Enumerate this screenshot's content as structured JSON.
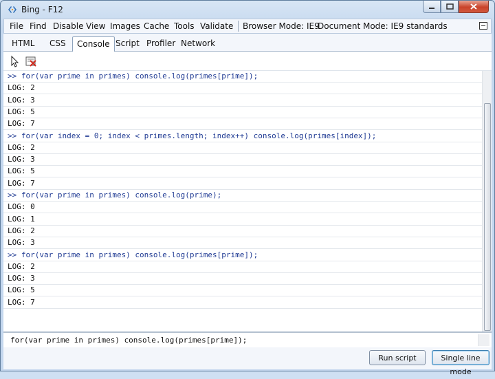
{
  "window": {
    "title": "Bing - F12"
  },
  "menubar": {
    "items": [
      "File",
      "Find",
      "Disable",
      "View",
      "Images",
      "Cache",
      "Tools",
      "Validate"
    ],
    "browser_mode": "Browser Mode: IE9",
    "document_mode": "Document Mode: IE9 standards"
  },
  "tabs": [
    "HTML",
    "CSS",
    "Console",
    "Script",
    "Profiler",
    "Network"
  ],
  "active_tab": "Console",
  "console": {
    "lines": [
      {
        "type": "cmd",
        "text": ">> for(var prime in primes) console.log(primes[prime]);"
      },
      {
        "type": "log",
        "text": "LOG: 2"
      },
      {
        "type": "log",
        "text": "LOG: 3"
      },
      {
        "type": "log",
        "text": "LOG: 5"
      },
      {
        "type": "log",
        "text": "LOG: 7"
      },
      {
        "type": "cmd",
        "text": ">> for(var index = 0; index < primes.length; index++) console.log(primes[index]);"
      },
      {
        "type": "log",
        "text": "LOG: 2"
      },
      {
        "type": "log",
        "text": "LOG: 3"
      },
      {
        "type": "log",
        "text": "LOG: 5"
      },
      {
        "type": "log",
        "text": "LOG: 7"
      },
      {
        "type": "cmd",
        "text": ">> for(var prime in primes) console.log(prime);"
      },
      {
        "type": "log",
        "text": "LOG: 0"
      },
      {
        "type": "log",
        "text": "LOG: 1"
      },
      {
        "type": "log",
        "text": "LOG: 2"
      },
      {
        "type": "log",
        "text": "LOG: 3"
      },
      {
        "type": "cmd",
        "text": ">> for(var prime in primes) console.log(primes[prime]);"
      },
      {
        "type": "log",
        "text": "LOG: 2"
      },
      {
        "type": "log",
        "text": "LOG: 3"
      },
      {
        "type": "log",
        "text": "LOG: 5"
      },
      {
        "type": "log",
        "text": "LOG: 7"
      }
    ]
  },
  "input": {
    "value": "for(var prime in primes) console.log(primes[prime]);"
  },
  "buttons": {
    "run": "Run script",
    "single_line": "Single line mode"
  },
  "colors": {
    "command_text": "#1f3a93",
    "title_bar": "#c4d7ee",
    "close_button": "#c9432a"
  }
}
